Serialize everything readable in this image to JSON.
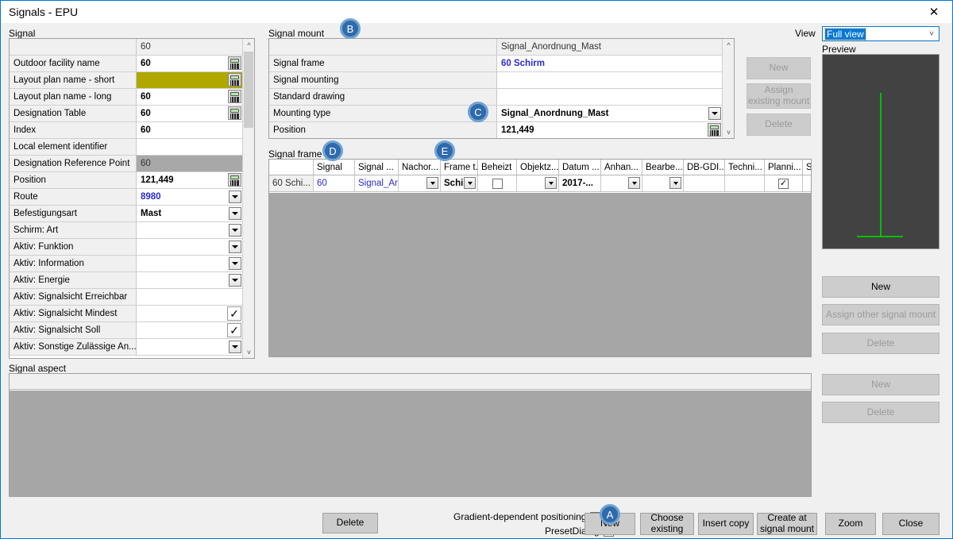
{
  "window": {
    "title": "Signals - EPU",
    "close_icon": "close-icon"
  },
  "groups": {
    "signal": "Signal",
    "signal_mount": "Signal mount",
    "signal_frame": "Signal frame",
    "signal_aspect": "Signal aspect",
    "preview": "Preview",
    "view_label": "View"
  },
  "view_combo": {
    "value": "Full view",
    "chevron": "chevron-down-icon"
  },
  "signal_grid": {
    "header_value": "60",
    "rows": [
      {
        "name": "Outdoor facility name",
        "value": "60",
        "style": "bold",
        "widget": "calc"
      },
      {
        "name": "Layout plan name - short",
        "value": "",
        "style": "olive",
        "widget": "calc"
      },
      {
        "name": "Layout plan name - long",
        "value": "60",
        "style": "bold",
        "widget": "calc"
      },
      {
        "name": "Designation Table",
        "value": "60",
        "style": "bold",
        "widget": "calc"
      },
      {
        "name": "Index",
        "value": "60",
        "style": "bold",
        "widget": "none"
      },
      {
        "name": "Local element identifier",
        "value": "",
        "style": "plain",
        "widget": "none"
      },
      {
        "name": "Designation Reference Point",
        "value": "60",
        "style": "grey",
        "widget": "none"
      },
      {
        "name": "Position",
        "value": "121,449",
        "style": "bold",
        "widget": "calc"
      },
      {
        "name": "Route",
        "value": "8980",
        "style": "blue",
        "widget": "dropdown"
      },
      {
        "name": "Befestigungsart",
        "value": "Mast",
        "style": "bold",
        "widget": "dropdown"
      },
      {
        "name": "Schirm: Art",
        "value": "",
        "style": "plain",
        "widget": "dropdown"
      },
      {
        "name": "Aktiv: Funktion",
        "value": "",
        "style": "plain",
        "widget": "dropdown"
      },
      {
        "name": "Aktiv: Information",
        "value": "",
        "style": "plain",
        "widget": "dropdown"
      },
      {
        "name": "Aktiv: Energie",
        "value": "",
        "style": "plain",
        "widget": "dropdown"
      },
      {
        "name": "Aktiv: Signalsicht Erreichbar",
        "value": "",
        "style": "plain",
        "widget": "none"
      },
      {
        "name": "Aktiv: Signalsicht Mindest",
        "value": "",
        "style": "plain",
        "widget": "check"
      },
      {
        "name": "Aktiv: Signalsicht Soll",
        "value": "",
        "style": "plain",
        "widget": "check"
      },
      {
        "name": "Aktiv: Sonstige Zulässige An...",
        "value": "",
        "style": "plain",
        "widget": "dropdown"
      }
    ]
  },
  "mount_grid": {
    "header_value": "Signal_Anordnung_Mast",
    "rows": [
      {
        "name": "Signal frame",
        "value": "60 Schirm",
        "style": "blue",
        "widget": "none"
      },
      {
        "name": "Signal mounting",
        "value": "",
        "style": "plain",
        "widget": "none"
      },
      {
        "name": "Standard drawing",
        "value": "",
        "style": "plain",
        "widget": "none"
      },
      {
        "name": "Mounting type",
        "value": "Signal_Anordnung_Mast",
        "style": "bold",
        "widget": "dropdown"
      },
      {
        "name": "Position",
        "value": "121,449",
        "style": "bold",
        "widget": "calc"
      }
    ]
  },
  "mount_buttons": {
    "new": "New",
    "assign_existing": "Assign existing mount",
    "delete": "Delete"
  },
  "frame_grid": {
    "columns": [
      "",
      "Signal",
      "Signal ...",
      "Nachor...",
      "Frame t...",
      "Beheizt",
      "Objektz...",
      "Datum ...",
      "Anhan...",
      "Bearbe...",
      "DB-GDI...",
      "Techni...",
      "Planni...",
      "Signal ..."
    ],
    "row": {
      "rowheader": "60 Schi...",
      "signal": "60",
      "signal2": "Signal_Ar",
      "nachor": "",
      "frame_type": "Schir",
      "beheizt_checked": false,
      "objektz": "",
      "datum": "2017-...",
      "anhang": "",
      "bearbeiter": "",
      "db_gdi": "",
      "techni": "",
      "planning_checked": true,
      "signal_last": ""
    }
  },
  "signal_mount_panel_buttons": {
    "new": "New",
    "assign_other": "Assign other signal mount",
    "delete": "Delete"
  },
  "aspect_buttons": {
    "new": "New",
    "delete": "Delete"
  },
  "bottom_bar": {
    "delete": "Delete",
    "gradient_label": "Gradient-dependent positioning",
    "gradient_checked": false,
    "preset_label": "PresetDialog",
    "preset_checked": true,
    "new": "New",
    "choose_existing_line1": "Choose",
    "choose_existing_line2": "existing",
    "insert_copy": "Insert copy",
    "create_at_line1": "Create at",
    "create_at_line2": "signal mount",
    "zoom": "Zoom",
    "close": "Close"
  },
  "badges": [
    {
      "id": "A",
      "label": "A"
    },
    {
      "id": "B",
      "label": "B"
    },
    {
      "id": "C",
      "label": "C"
    },
    {
      "id": "D",
      "label": "D"
    },
    {
      "id": "E",
      "label": "E"
    }
  ],
  "colors": {
    "accent": "#0078d7",
    "badge_fill": "#2f6aad",
    "badge_ring": "#6fa3d2",
    "olive_highlight": "#b0a800",
    "preview_bg": "#424242",
    "preview_line": "#00c000",
    "grid_empty": "#a6a6a6"
  }
}
